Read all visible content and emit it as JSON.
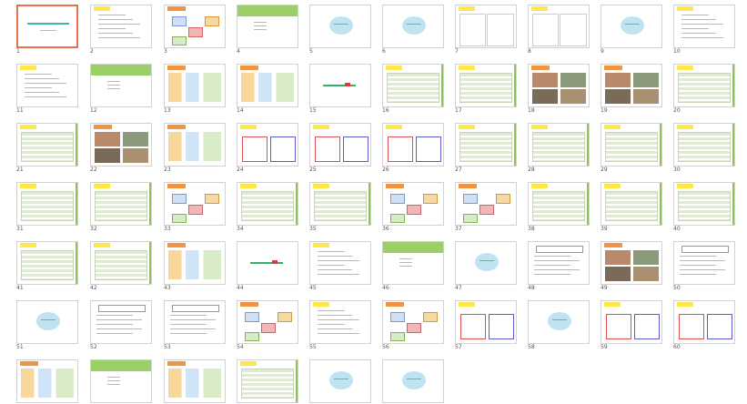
{
  "view": "slide-sorter",
  "selected_slide": 1,
  "colors": {
    "selection": "#e8734a",
    "accent_green": "#9bd069",
    "oval_blue": "#bfe3f1"
  },
  "slides": [
    "1",
    "2",
    "3",
    "4",
    "5",
    "6",
    "7",
    "8",
    "9",
    "10",
    "11",
    "12",
    "13",
    "14",
    "15",
    "16",
    "17",
    "18",
    "19",
    "20",
    "21",
    "22",
    "23",
    "24",
    "25",
    "26",
    "27",
    "28",
    "29",
    "30",
    "31",
    "32",
    "33",
    "34",
    "35",
    "36",
    "37",
    "38",
    "39",
    "40",
    "41",
    "42",
    "43",
    "44",
    "45",
    "46",
    "47",
    "48",
    "49",
    "50",
    "51",
    "52",
    "53",
    "54",
    "55",
    "56",
    "57",
    "58",
    "59",
    "60",
    "61",
    "62",
    "63",
    "64",
    "65",
    "66"
  ]
}
